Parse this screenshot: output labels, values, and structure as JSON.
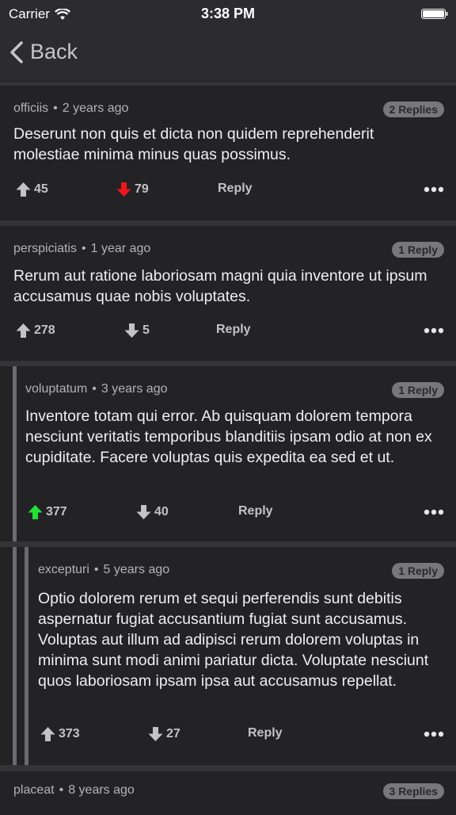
{
  "status": {
    "carrier": "Carrier",
    "time": "3:38 PM"
  },
  "nav": {
    "back_label": "Back"
  },
  "comments": [
    {
      "author": "officiis",
      "age": "2 years ago",
      "replies": "2 Replies",
      "text": "Deserunt non quis et dicta non quidem reprehenderit molestiae minima minus quas possimus.",
      "up": "45",
      "down": "79",
      "reply": "Reply",
      "vote": "down"
    },
    {
      "author": "perspiciatis",
      "age": "1 year ago",
      "replies": "1 Reply",
      "text": "Rerum aut ratione laboriosam magni quia inventore ut ipsum accusamus quae nobis voluptates.",
      "up": "278",
      "down": "5",
      "reply": "Reply",
      "vote": "none"
    },
    {
      "author": "voluptatum",
      "age": "3 years ago",
      "replies": "1 Reply",
      "text": "Inventore totam qui error. Ab quisquam dolorem tempora nesciunt veritatis temporibus blanditiis ipsam odio at non ex cupiditate. Facere voluptas quis expedita ea sed et ut.",
      "up": "377",
      "down": "40",
      "reply": "Reply",
      "vote": "up"
    },
    {
      "author": "excepturi",
      "age": "5 years ago",
      "replies": "1 Reply",
      "text": "Optio dolorem rerum et sequi perferendis sunt debitis aspernatur fugiat accusantium fugiat sunt accusamus. Voluptas aut illum ad adipisci rerum dolorem voluptas in minima sunt modi animi pariatur dicta. Voluptate nesciunt quos laboriosam ipsam ipsa aut accusamus repellat.",
      "up": "373",
      "down": "27",
      "reply": "Reply",
      "vote": "none"
    },
    {
      "author": "placeat",
      "age": "8 years ago",
      "replies": "3 Replies"
    }
  ],
  "colors": {
    "upvoted": "#22e035",
    "downvoted": "#f0161b",
    "neutral": "#c3c3c6"
  },
  "icons": {
    "up": "arrow-up-icon",
    "down": "arrow-down-icon",
    "more": "more-dots-icon",
    "back": "chevron-left-icon"
  }
}
